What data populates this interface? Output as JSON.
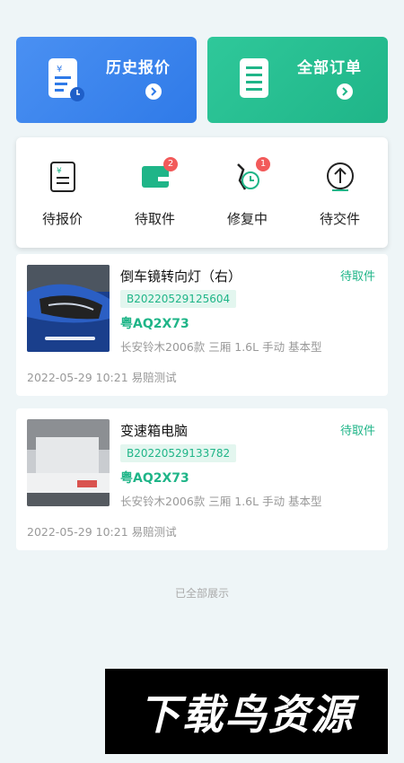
{
  "quick_actions": {
    "history": {
      "label": "历史报价"
    },
    "orders": {
      "label": "全部订单"
    }
  },
  "status_tabs": [
    {
      "label": "待报价",
      "badge": ""
    },
    {
      "label": "待取件",
      "badge": "2"
    },
    {
      "label": "修复中",
      "badge": "1"
    },
    {
      "label": "待交件",
      "badge": ""
    }
  ],
  "orders": [
    {
      "title": "倒车镜转向灯（右）",
      "status": "待取件",
      "order_no": "B20220529125604",
      "plate": "粤AQ2X73",
      "model": "长安铃木2006款 三厢 1.6L 手动 基本型",
      "footer": "2022-05-29 10:21 易赔测试"
    },
    {
      "title": "变速箱电脑",
      "status": "待取件",
      "order_no": "B20220529133782",
      "plate": "粤AQ2X73",
      "model": "长安铃木2006款 三厢 1.6L 手动 基本型",
      "footer": "2022-05-29 10:21 易赔测试"
    }
  ],
  "footer_note": "已全部展示",
  "watermark": "下载鸟资源",
  "colors": {
    "blue": "#2f7ae8",
    "green": "#1fb588",
    "badge": "#f25a5a"
  }
}
